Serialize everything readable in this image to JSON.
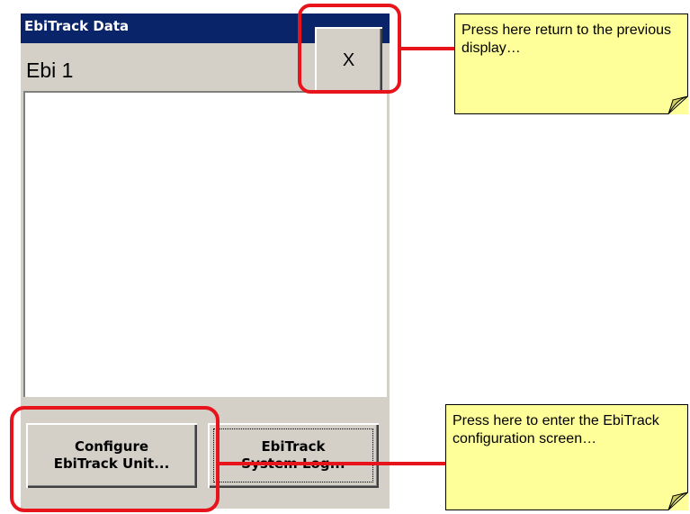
{
  "window": {
    "title": "EbiTrack Data",
    "unit_name": "Ebi 1",
    "close_label": "X"
  },
  "buttons": {
    "configure_line1": "Configure",
    "configure_line2": "EbiTrack Unit...",
    "syslog_line1": "EbiTrack",
    "syslog_line2": "System Log..."
  },
  "callouts": {
    "close_note": "Press here return to the previous display…",
    "configure_note": "Press here to enter the EbiTrack configuration screen…"
  },
  "colors": {
    "titlebar": "#0a246a",
    "window_face": "#d4d0c8",
    "highlight": "#e8141b",
    "note": "#ffff99"
  }
}
